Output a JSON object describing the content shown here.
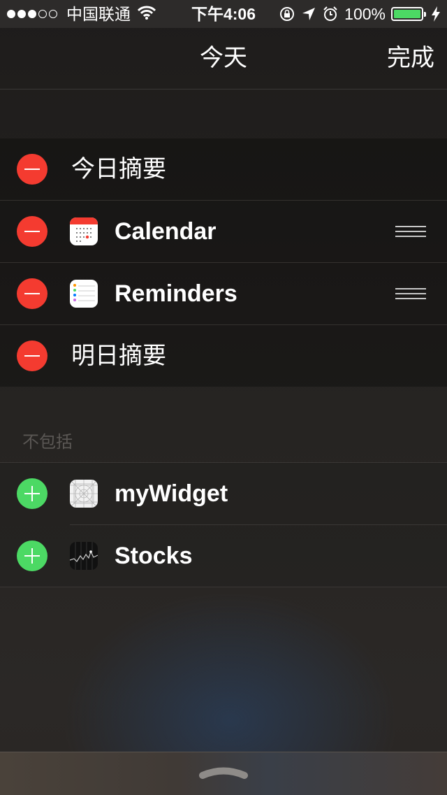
{
  "status_bar": {
    "signal_dots_filled": 3,
    "signal_dots_total": 5,
    "carrier": "中国联通",
    "time": "下午4:06",
    "battery": "100%",
    "battery_level": 1.0,
    "icons": [
      "wifi-icon",
      "rotation-lock-icon",
      "location-icon",
      "alarm-icon",
      "charging-bolt-icon"
    ]
  },
  "nav": {
    "title": "今天",
    "done": "完成"
  },
  "included": [
    {
      "label": "今日摘要"
    },
    {
      "label": "Calendar",
      "icon": "calendar-icon"
    },
    {
      "label": "Reminders",
      "icon": "reminders-icon"
    },
    {
      "label": "明日摘要"
    }
  ],
  "excluded_header": "不包括",
  "excluded": [
    {
      "label": "myWidget",
      "icon": "app-placeholder-icon"
    },
    {
      "label": "Stocks",
      "icon": "stocks-icon"
    }
  ],
  "colors": {
    "remove": "#f43b30",
    "add": "#4cd964",
    "battery": "#4cd964"
  }
}
